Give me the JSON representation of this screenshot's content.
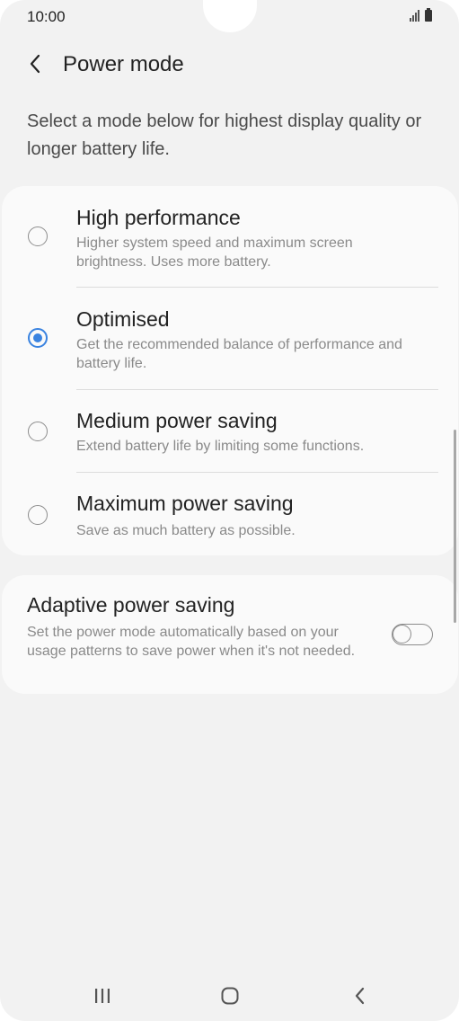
{
  "status": {
    "time": "10:00",
    "icons": [
      "signal-icon",
      "battery-icon"
    ]
  },
  "appbar": {
    "title": "Power mode",
    "back_icon": "chevron-left-icon"
  },
  "description": "Select a mode below for highest display quality or longer battery life.",
  "modes": [
    {
      "title": "High performance",
      "subtitle": "Higher system speed and maximum screen brightness. Uses more battery.",
      "selected": false
    },
    {
      "title": "Optimised",
      "subtitle": "Get the recommended balance of performance and battery life.",
      "selected": true
    },
    {
      "title": "Medium power saving",
      "subtitle": "Extend battery life by limiting some functions.",
      "selected": false
    },
    {
      "title": "Maximum power saving",
      "subtitle": "Save as much battery as possible.",
      "selected": false
    }
  ],
  "adaptive": {
    "title": "Adaptive power saving",
    "subtitle": "Set the power mode automatically based on your usage patterns to save power when it's not needed.",
    "enabled": false
  },
  "colors": {
    "accent": "#3a83e0",
    "background": "#f2f2f2",
    "card": "#fafafa"
  },
  "navbar": {
    "icons": [
      "recent-apps-icon",
      "home-icon",
      "back-icon"
    ]
  }
}
